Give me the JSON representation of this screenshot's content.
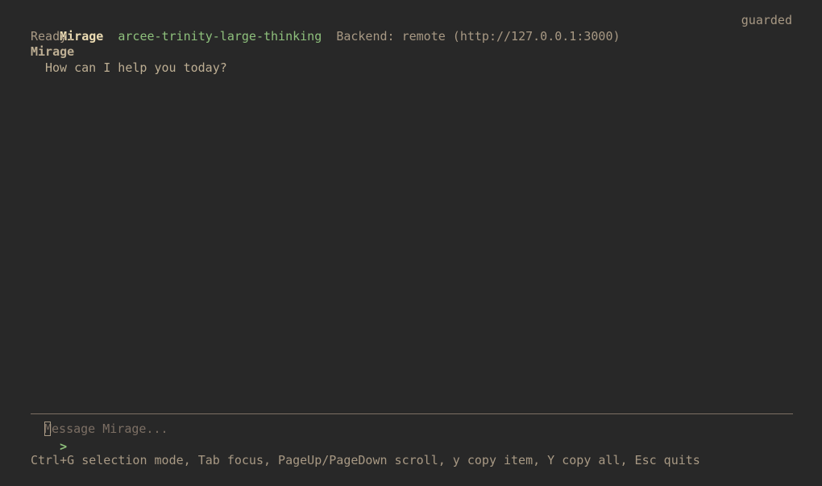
{
  "header": {
    "app_name": "Mirage",
    "model": "arcee-trinity-large-thinking",
    "backend": "Backend: remote (http://127.0.0.1:3000)",
    "mode": "guarded"
  },
  "status": "Ready.",
  "messages": [
    {
      "author": "Mirage",
      "text": "How can I help you today?"
    }
  ],
  "input": {
    "prompt": ">",
    "placeholder": "Message Mirage...",
    "value": ""
  },
  "hints": "Ctrl+G selection mode, Tab focus, PageUp/PageDown scroll, y copy item, Y copy all, Esc quits",
  "colors": {
    "background": "#282828",
    "title": "#ebdbb2",
    "accent_green": "#8ec07c",
    "muted_text": "#a89984",
    "divider": "#7c6f64"
  }
}
